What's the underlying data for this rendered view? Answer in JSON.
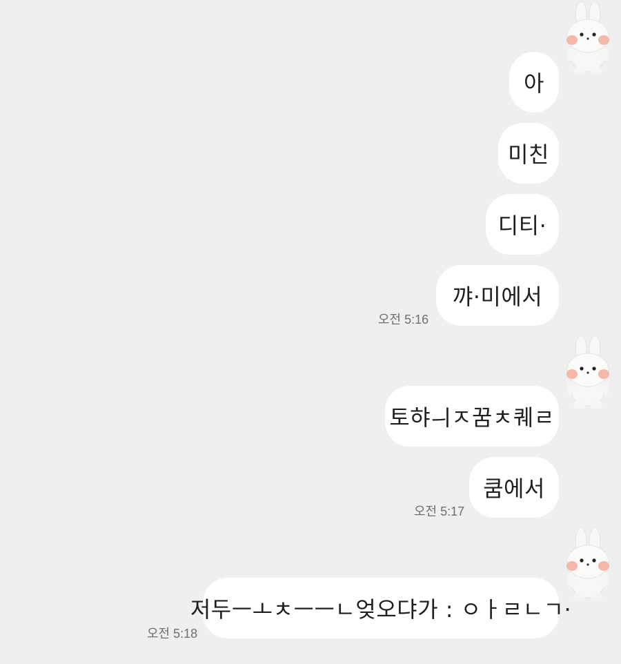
{
  "groups": [
    {
      "messages": [
        "아",
        "미친",
        "디티·",
        "꺄·미에서"
      ],
      "time": "오전 5:16"
    },
    {
      "messages": [
        "토햐ㅢㅈ꿈ㅊ퀘ㄹ",
        "쿰에서"
      ],
      "time": "오전 5:17"
    },
    {
      "messages": [
        "저두ㅡㅗㅊㅡㅡㄴ엊오댜가 : ㅇㅏㄹㄴㄱ·"
      ],
      "time": "오전 5:18"
    }
  ],
  "avatar": {
    "icon": "bunny-plush-avatar-icon"
  },
  "colors": {
    "background": "#efefef",
    "bubble": "#ffffff",
    "text": "#1f1f1f",
    "timestamp": "#6e6e6e"
  }
}
